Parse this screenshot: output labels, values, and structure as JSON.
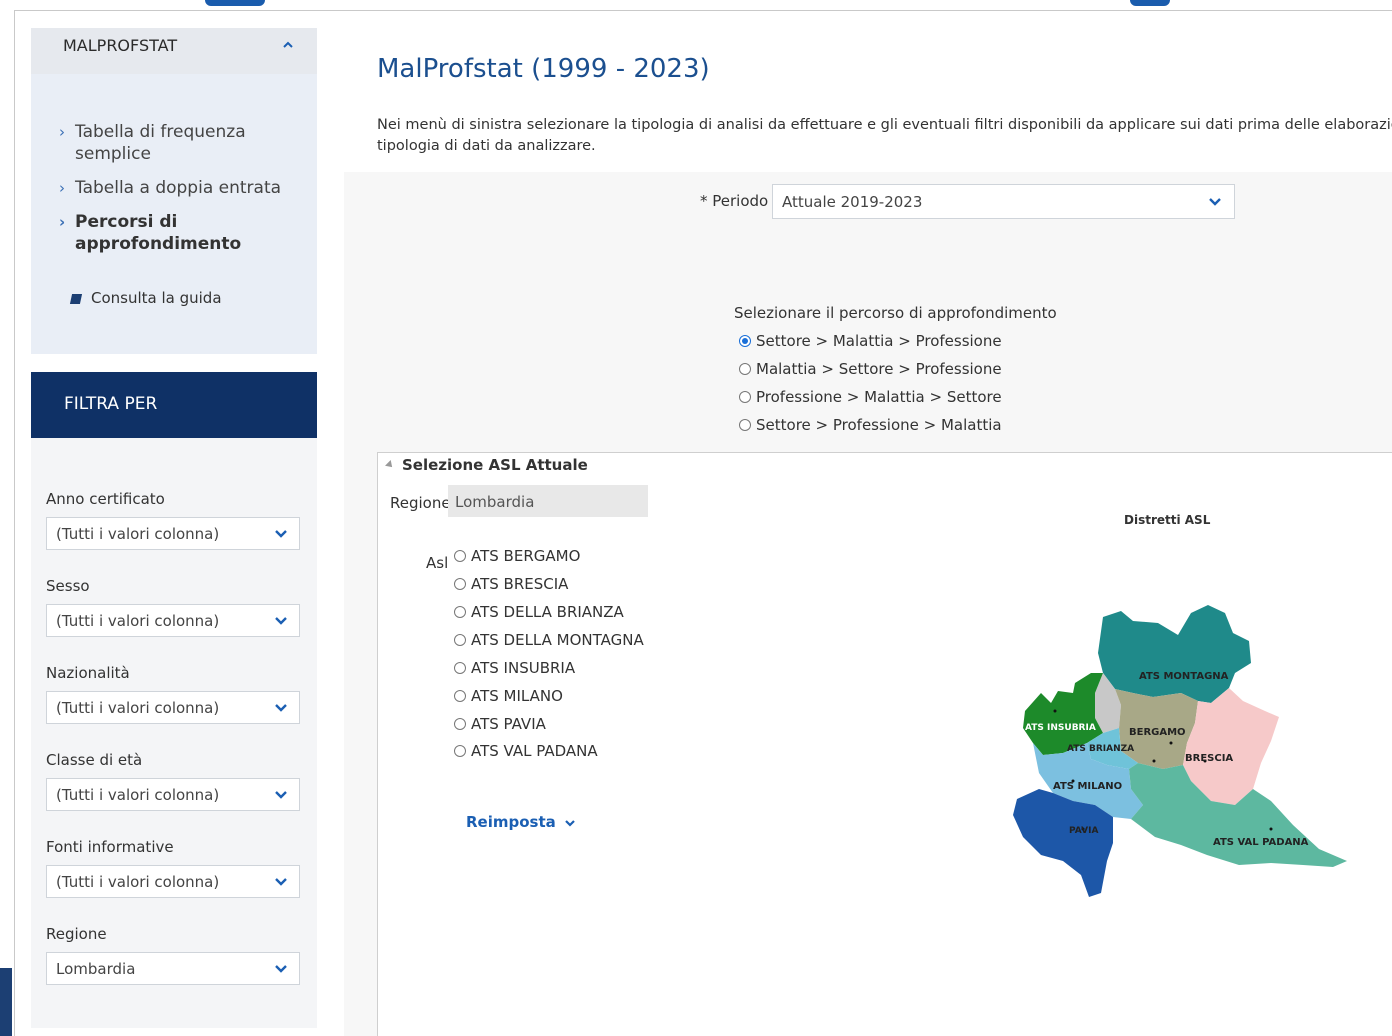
{
  "nav": {
    "header": "MALPROFSTAT",
    "items": [
      {
        "label": "Tabella di frequenza semplice"
      },
      {
        "label": "Tabella a doppia entrata"
      },
      {
        "label": "Percorsi di approfondimento"
      }
    ],
    "guide": "Consulta la guida"
  },
  "filters": {
    "title": "FILTRA PER",
    "fields": [
      {
        "label": "Anno certificato",
        "value": "(Tutti i valori colonna)"
      },
      {
        "label": "Sesso",
        "value": "(Tutti i valori colonna)"
      },
      {
        "label": "Nazionalità",
        "value": "(Tutti i valori colonna)"
      },
      {
        "label": "Classe di età",
        "value": "(Tutti i valori colonna)"
      },
      {
        "label": "Fonti informative",
        "value": "(Tutti i valori colonna)"
      },
      {
        "label": "Regione",
        "value": "Lombardia"
      }
    ]
  },
  "main": {
    "title": "MalProfstat (1999 - 2023)",
    "intro_line1": "Nei menù di sinistra selezionare la tipologia di analisi da effettuare e gli eventuali filtri disponibili da applicare sui dati prima delle elaborazioni",
    "intro_line2": "tipologia di dati da analizzare.",
    "periodo_label": "* Periodo",
    "periodo_value": "Attuale 2019-2023",
    "percorso_title": "Selezionare il percorso di approfondimento",
    "percorsi": [
      {
        "label": "Settore > Malattia > Professione",
        "selected": true
      },
      {
        "label": "Malattia > Settore > Professione",
        "selected": false
      },
      {
        "label": "Professione > Malattia > Settore",
        "selected": false
      },
      {
        "label": "Settore > Professione > Malattia",
        "selected": false
      }
    ]
  },
  "asl": {
    "panel_title": "Selezione ASL Attuale",
    "region_label": "Regione",
    "region_value": "Lombardia",
    "asl_label": "Asl",
    "options": [
      "ATS BERGAMO",
      "ATS BRESCIA",
      "ATS DELLA BRIANZA",
      "ATS DELLA MONTAGNA",
      "ATS INSUBRIA",
      "ATS MILANO",
      "ATS PAVIA",
      "ATS VAL PADANA"
    ],
    "reset_label": "Reimposta",
    "map_title": "Distretti ASL",
    "map_labels": {
      "montagna": "ATS MONTAGNA",
      "insubria": "ATS INSUBRIA",
      "bergamo": "BERGAMO",
      "brianza": "ATS BRIANZA",
      "brescia": "BRESCIA",
      "milano": "ATS MILANO",
      "pavia": "PAVIA",
      "valpadana": "ATS VAL PADANA"
    },
    "map_colors": {
      "montagna": "#1f8a8a",
      "insubria": "#1d8a2a",
      "gray": "#c8c8c8",
      "bergamo": "#a8a887",
      "brianza": "#6fc3d9",
      "brescia": "#f6c9c9",
      "milano": "#7cc0e0",
      "pavia": "#1d57a8",
      "valpadana": "#5db8a0"
    }
  },
  "colors": {
    "accent": "#1b4f8f",
    "nav_dark": "#0f3166",
    "radio_selected": "#1a6fd8"
  }
}
